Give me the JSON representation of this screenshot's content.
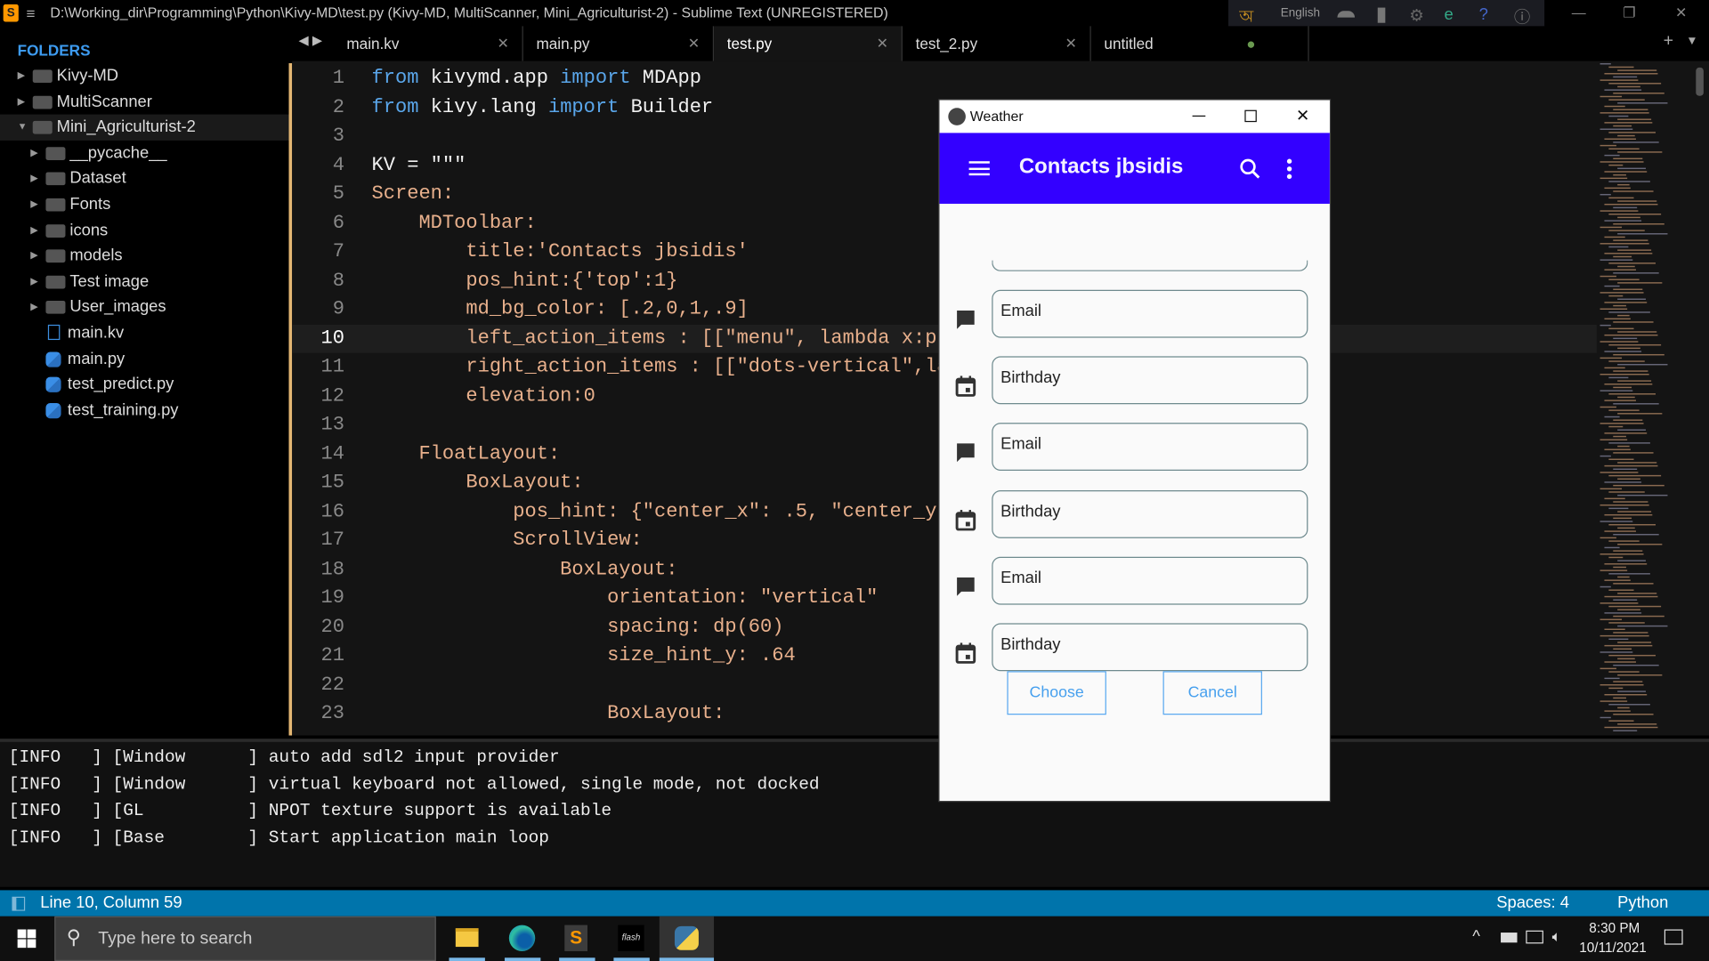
{
  "window": {
    "title": "D:\\Working_dir\\Programming\\Python\\Kivy-MD\\test.py (Kivy-MD, MultiScanner, Mini_Agriculturist-2) - Sublime Text (UNREGISTERED)"
  },
  "ime": {
    "language": "English"
  },
  "tabs": [
    {
      "label": "main.kv"
    },
    {
      "label": "main.py"
    },
    {
      "label": "test.py",
      "active": true
    },
    {
      "label": "test_2.py"
    },
    {
      "label": "untitled",
      "dirty": true
    }
  ],
  "sidebar": {
    "heading": "FOLDERS",
    "items": [
      {
        "label": "Kivy-MD",
        "type": "folder",
        "depth": 0
      },
      {
        "label": "MultiScanner",
        "type": "folder",
        "depth": 0
      },
      {
        "label": "Mini_Agriculturist-2",
        "type": "folder-open",
        "depth": 0
      },
      {
        "label": "__pycache__",
        "type": "folder",
        "depth": 1
      },
      {
        "label": "Dataset",
        "type": "folder",
        "depth": 1
      },
      {
        "label": "Fonts",
        "type": "folder",
        "depth": 1
      },
      {
        "label": "icons",
        "type": "folder",
        "depth": 1
      },
      {
        "label": "models",
        "type": "folder",
        "depth": 1
      },
      {
        "label": "Test image",
        "type": "folder",
        "depth": 1
      },
      {
        "label": "User_images",
        "type": "folder",
        "depth": 1
      },
      {
        "label": "main.kv",
        "type": "file-kv",
        "depth": 1
      },
      {
        "label": "main.py",
        "type": "file-py",
        "depth": 1
      },
      {
        "label": "test_predict.py",
        "type": "file-py",
        "depth": 1
      },
      {
        "label": "test_training.py",
        "type": "file-py",
        "depth": 1
      }
    ]
  },
  "editor": {
    "current_line": 10,
    "lines": [
      [
        [
          "from",
          "kw"
        ],
        [
          " kivymd.app ",
          "pl"
        ],
        [
          "import",
          "kw"
        ],
        [
          " MDApp",
          "pl"
        ]
      ],
      [
        [
          "from",
          "kw"
        ],
        [
          " kivy.lang ",
          "pl"
        ],
        [
          "import",
          "kw"
        ],
        [
          " Builder",
          "pl"
        ]
      ],
      [],
      [
        [
          "KV = \"\"\"",
          "pl"
        ]
      ],
      [
        [
          "Screen:",
          "kv"
        ]
      ],
      [
        [
          "    MDToolbar:",
          "kv"
        ]
      ],
      [
        [
          "        title:'Contacts jbsidis'",
          "kv"
        ]
      ],
      [
        [
          "        pos_hint:{'top':1}",
          "kv"
        ]
      ],
      [
        [
          "        md_bg_color: [.2,0,1,.9]",
          "kv"
        ]
      ],
      [
        [
          "        left_action_items : [[\"menu\", lambda x:pr",
          "kv"
        ]
      ],
      [
        [
          "        right_action_items : [[\"dots-vertical\",la",
          "kv"
        ]
      ],
      [
        [
          "        elevation:0",
          "kv"
        ]
      ],
      [],
      [
        [
          "    FloatLayout:",
          "kv"
        ]
      ],
      [
        [
          "        BoxLayout:",
          "kv"
        ]
      ],
      [
        [
          "            pos_hint: {\"center_x\": .5, \"center_y\"",
          "kv"
        ]
      ],
      [
        [
          "            ScrollView:",
          "kv"
        ]
      ],
      [
        [
          "                BoxLayout:",
          "kv"
        ]
      ],
      [
        [
          "                    orientation: \"vertical\"",
          "kv"
        ]
      ],
      [
        [
          "                    spacing: dp(60)",
          "kv"
        ]
      ],
      [
        [
          "                    size_hint_y: .64",
          "kv"
        ]
      ],
      [],
      [
        [
          "                    BoxLayout:",
          "kv"
        ]
      ]
    ]
  },
  "console": {
    "lines": [
      "[INFO   ] [Window      ] auto add sdl2 input provider",
      "[INFO   ] [Window      ] virtual keyboard not allowed, single mode, not docked",
      "[INFO   ] [GL          ] NPOT texture support is available",
      "[INFO   ] [Base        ] Start application main loop"
    ]
  },
  "status": {
    "position": "Line 10, Column 59",
    "indent": "Spaces: 4",
    "syntax": "Python"
  },
  "app": {
    "window_title": "Weather",
    "toolbar_title": "Contacts jbsidis",
    "toolbar_color": "#3300ff",
    "fields": [
      {
        "hint": "Email",
        "icon": "message-icon"
      },
      {
        "hint": "Birthday",
        "icon": "calendar-icon"
      },
      {
        "hint": "Email",
        "icon": "message-icon"
      },
      {
        "hint": "Birthday",
        "icon": "calendar-icon"
      },
      {
        "hint": "Email",
        "icon": "message-icon"
      },
      {
        "hint": "Birthday",
        "icon": "calendar-icon"
      }
    ],
    "choose_label": "Choose",
    "cancel_label": "Cancel"
  },
  "taskbar": {
    "search_placeholder": "Type here to search",
    "time": "8:30 PM",
    "date": "10/11/2021",
    "apps": [
      "file-explorer",
      "edge",
      "sublime-text",
      "flash",
      "python"
    ]
  }
}
